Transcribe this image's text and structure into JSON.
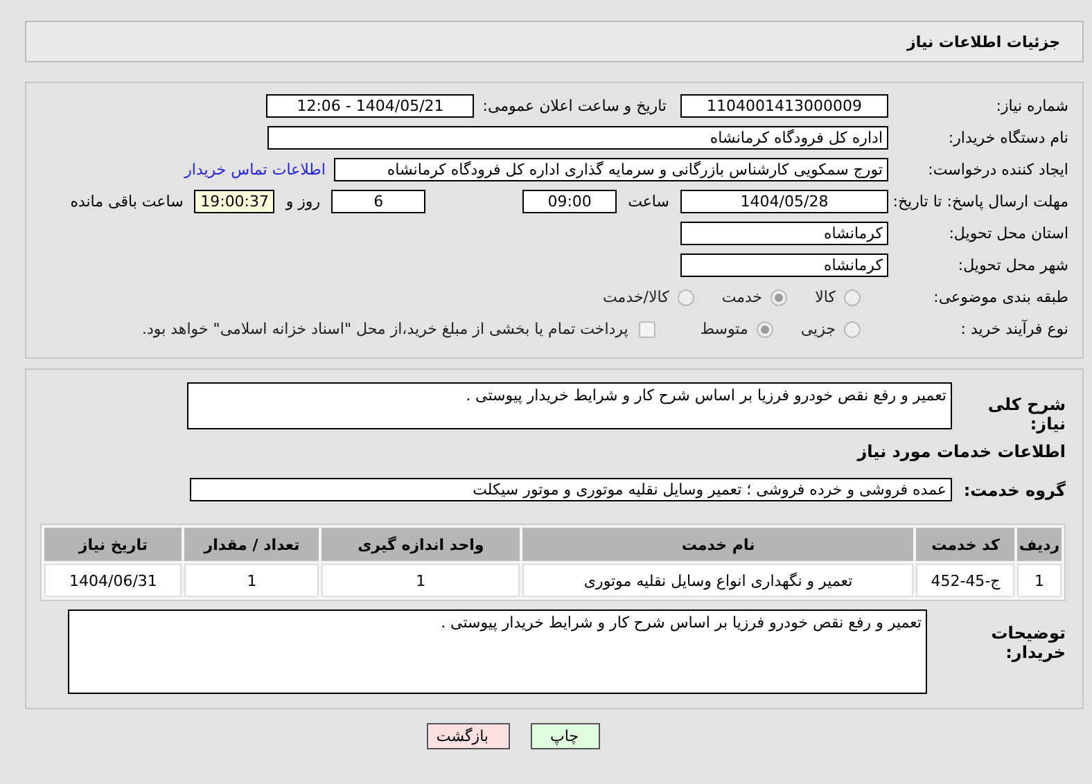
{
  "title": "جزئیات اطلاعات نیاز",
  "need_number": {
    "label": "شماره نیاز:",
    "value": "1104001413000009"
  },
  "announce": {
    "label": "تاریخ و ساعت اعلان عمومی:",
    "value": "1404/05/21 - 12:06"
  },
  "buyer_org": {
    "label": "نام دستگاه خریدار:",
    "value": "اداره کل فرودگاه کرمانشاه"
  },
  "requester": {
    "label": "ایجاد کننده درخواست:",
    "value": "تورج سمکویی کارشناس بازرگانی و سرمایه گذاری اداره کل فرودگاه کرمانشاه",
    "link": "اطلاعات تماس خریدار"
  },
  "deadline": {
    "label": "مهلت ارسال پاسخ: تا تاریخ:",
    "date": "1404/05/28",
    "time_label": "ساعت",
    "time": "09:00",
    "days": "6",
    "days_label": "روز و",
    "remaining": "19:00:37",
    "remaining_label": "ساعت باقی مانده"
  },
  "province": {
    "label": "استان محل تحویل:",
    "value": "کرمانشاه"
  },
  "city": {
    "label": "شهر محل تحویل:",
    "value": "کرمانشاه"
  },
  "category": {
    "label": "طبقه بندی موضوعی:",
    "options": [
      {
        "label": "کالا",
        "selected": false
      },
      {
        "label": "خدمت",
        "selected": true
      },
      {
        "label": "کالا/خدمت",
        "selected": false
      }
    ]
  },
  "process": {
    "label": "نوع فرآیند خرید :",
    "options": [
      {
        "label": "جزیی",
        "selected": false
      },
      {
        "label": "متوسط",
        "selected": true
      }
    ],
    "checkbox": {
      "label": "پرداخت تمام یا بخشی از مبلغ خرید،از محل \"اسناد خزانه اسلامی\" خواهد بود.",
      "checked": false
    }
  },
  "description": {
    "label": "شرح کلی نیاز:",
    "value": "تعمیر و رفع نقص خودرو فرزیا بر اساس شرح کار و شرایط خریدار پیوستی ."
  },
  "services_title": "اطلاعات خدمات مورد نیاز",
  "service_group": {
    "label": "گروه خدمت:",
    "value": "عمده فروشی و خرده فروشی ؛ تعمیر وسایل نقلیه موتوری و موتور سیکلت"
  },
  "table": {
    "columns": [
      "ردیف",
      "کد خدمت",
      "نام خدمت",
      "واحد اندازه گیری",
      "تعداد / مقدار",
      "تاریخ نیاز"
    ],
    "rows": [
      [
        "1",
        "ج-45-452",
        "تعمیر و نگهداری انواع وسایل نقلیه موتوری",
        "1",
        "1",
        "1404/06/31"
      ]
    ]
  },
  "buyer_notes": {
    "label": "توضیحات خریدار:",
    "value": "تعمیر و رفع نقص خودرو فرزیا بر اساس شرح کار و شرایط خریدار پیوستی ."
  },
  "buttons": [
    {
      "label": "چاپ",
      "kind": "print"
    },
    {
      "label": "بازگشت",
      "kind": "back"
    }
  ]
}
